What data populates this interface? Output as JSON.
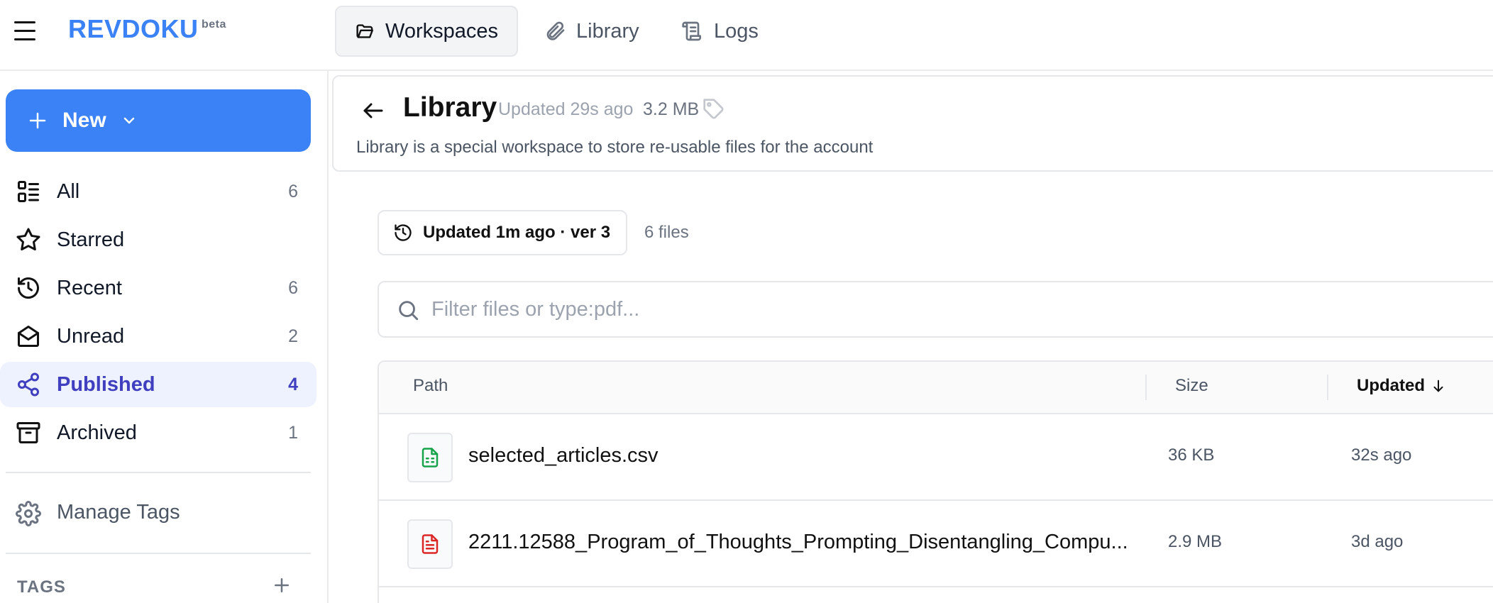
{
  "app": {
    "logo": "REVDOKU",
    "badge": "beta"
  },
  "top_tabs": [
    {
      "label": "Workspaces",
      "icon": "folder-open-icon",
      "active": true
    },
    {
      "label": "Library",
      "icon": "paperclip-icon"
    },
    {
      "label": "Logs",
      "icon": "scroll-icon"
    }
  ],
  "sidebar": {
    "new_button": "New",
    "items": [
      {
        "label": "All",
        "count": "6",
        "icon": "list-icon"
      },
      {
        "label": "Starred",
        "count": "",
        "icon": "star-icon"
      },
      {
        "label": "Recent",
        "count": "6",
        "icon": "history-icon"
      },
      {
        "label": "Unread",
        "count": "2",
        "icon": "mail-open-icon"
      },
      {
        "label": "Published",
        "count": "4",
        "icon": "share-icon",
        "active": true
      },
      {
        "label": "Archived",
        "count": "1",
        "icon": "archive-icon"
      }
    ],
    "manage_tags": "Manage Tags",
    "tags_header": "TAGS"
  },
  "library": {
    "title": "Library",
    "updated": "Updated 29s ago",
    "size": "3.2 MB",
    "description": "Library is a special workspace to store re-usable files for the account"
  },
  "version": {
    "label": "Updated 1m ago · ver 3",
    "file_count": "6 files"
  },
  "search": {
    "placeholder": "Filter files or type:pdf...",
    "value": ""
  },
  "table": {
    "columns": {
      "path": "Path",
      "size": "Size",
      "updated": "Updated"
    },
    "rows": [
      {
        "name": "selected_articles.csv",
        "size": "36 KB",
        "updated": "32s ago",
        "type": "csv",
        "color": "#16a34a"
      },
      {
        "name": "2211.12588_Program_of_Thoughts_Prompting_Disentangling_Compu...",
        "size": "2.9 MB",
        "updated": "3d ago",
        "type": "pdf",
        "color": "#dc2626"
      }
    ]
  },
  "colors": {
    "accent": "#3b82f6",
    "active_nav": "#3f3fbf"
  }
}
